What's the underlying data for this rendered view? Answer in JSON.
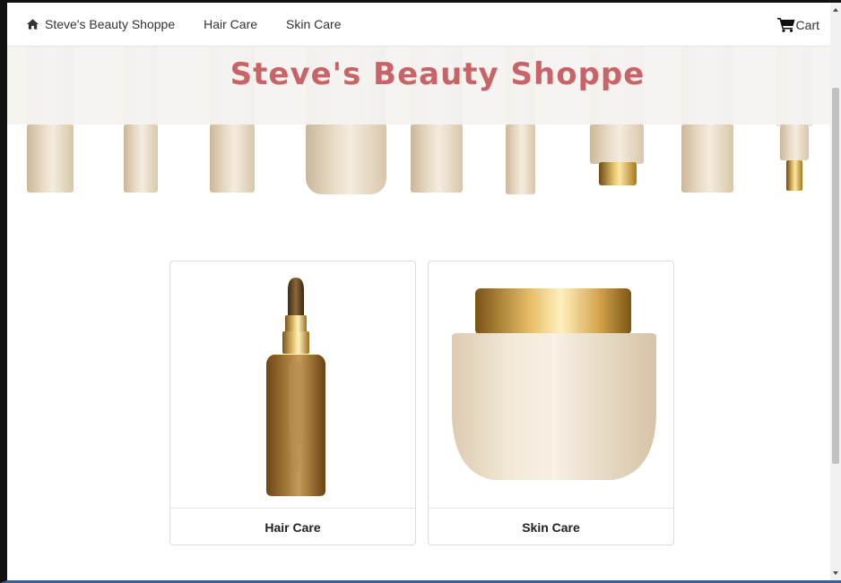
{
  "navbar": {
    "brand_label": "Steve's Beauty Shoppe",
    "links": [
      "Hair Care",
      "Skin Care"
    ],
    "cart_label": "Cart"
  },
  "hero": {
    "title": "Steve's Beauty Shoppe"
  },
  "categories": [
    {
      "label": "Hair Care",
      "image": "dropper-bottle"
    },
    {
      "label": "Skin Care",
      "image": "cream-jar"
    }
  ],
  "colors": {
    "title": "#c86468",
    "text": "#333333",
    "border": "#dcdcdc"
  }
}
